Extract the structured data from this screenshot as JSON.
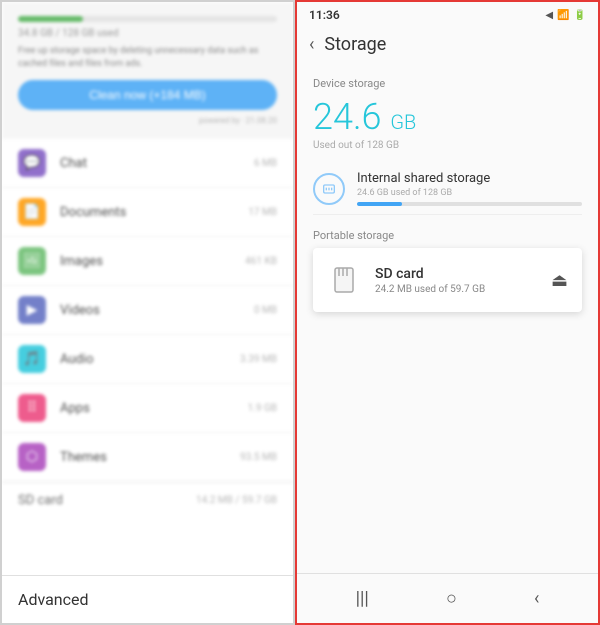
{
  "left": {
    "storage_label": "34.8 GB / 128 GB used",
    "free_up_text": "Free up storage space by deleting unnecessary data such as cached files and files from ads.",
    "clean_btn_label": "Clean now (+184 MB)",
    "powered_text": "powered by · 21.08.20",
    "app_list": [
      {
        "name": "Chat",
        "size": "6 MB",
        "icon": "chat"
      },
      {
        "name": "Documents",
        "size": "17 MB",
        "icon": "docs"
      },
      {
        "name": "Images",
        "size": "461 KB",
        "icon": "images"
      },
      {
        "name": "Videos",
        "size": "0 MB",
        "icon": "videos"
      },
      {
        "name": "Audio",
        "size": "3.39 MB",
        "icon": "audio"
      },
      {
        "name": "Apps",
        "size": "1.9 GB",
        "icon": "apps"
      },
      {
        "name": "Themes",
        "size": "93.5 MB",
        "icon": "themes"
      }
    ],
    "sd_card_label": "SD card",
    "sd_card_size": "14.2 MB / 59.7 GB",
    "advanced_label": "Advanced"
  },
  "right": {
    "status_time": "11:36",
    "status_icons": "◀ ◀ 📶 🔋",
    "back_label": "‹",
    "page_title": "Storage",
    "device_storage_section": "Device storage",
    "storage_gb": "24.6",
    "storage_gb_unit": "GB",
    "used_out_of": "Used out of 128 GB",
    "internal_name": "Internal shared storage",
    "internal_sub": "24.6 GB used of 128 GB",
    "portable_section": "Portable storage",
    "sd_popup_name": "SD card",
    "sd_popup_sub": "24.2 MB used of 59.7 GB",
    "bottom_nav": [
      "|||",
      "○",
      "‹"
    ]
  }
}
